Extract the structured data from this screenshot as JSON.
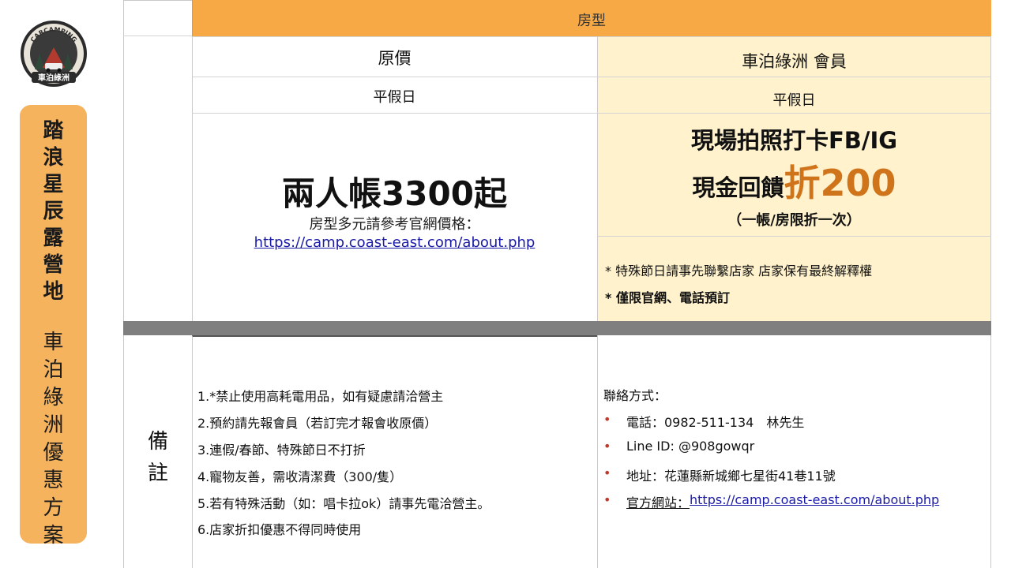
{
  "logo": {
    "ring_text": "CARCAMPING",
    "plate_text": "車泊綠洲"
  },
  "side_panel": {
    "title_chars": [
      "踏",
      "浪",
      "星",
      "辰",
      "露",
      "營",
      "地"
    ],
    "subtitle_chars": [
      "車",
      "泊",
      "綠",
      "洲",
      "優",
      "惠",
      "方",
      "案"
    ]
  },
  "table": {
    "header": "房型",
    "col_left_title": "原價",
    "col_right_title": "車泊綠洲 會員",
    "weekday_left": "平假日",
    "weekday_right": "平假日",
    "big_price": "兩人帳3300起",
    "price_note": "房型多元請參考官網價格：",
    "price_link": "https://camp.coast-east.com/about.php",
    "promo_line1": "現場拍照打卡FB/IG",
    "promo_line2_prefix": "現金回饋",
    "promo_highlight": "折200",
    "promo_limit": "（一帳/房限折一次）",
    "note_1": "* 特殊節日請事先聯繫店家 店家保有最終解釋權",
    "note_2": "* 僅限官網、電話預訂"
  },
  "remarks": {
    "label_chars": [
      "備",
      "註"
    ],
    "rules": [
      "1.*禁止使用高耗電用品，如有疑慮請洽營主",
      "2.預約請先報會員（若訂完才報會收原價）",
      "3.連假/春節、特殊節日不打折",
      "4.寵物友善，需收清潔費（300/隻）",
      "5.若有特殊活動（如：唱卡拉ok）請事先電洽營主。",
      "6.店家折扣優惠不得同時使用"
    ],
    "contact_title": "聯絡方式：",
    "bullet": "•",
    "contact_phone": "電話：0982-511-134　林先生",
    "contact_line": "Line ID: @908gowqr",
    "contact_address": "地址：花蓮縣新城鄉七星街41巷11號",
    "contact_site_label": "官方網站：",
    "contact_site_url": "https://camp.coast-east.com/about.php"
  },
  "colors": {
    "header_orange": "#f7a945",
    "side_pill_orange": "#f5b35d",
    "member_cream": "#fff2cc",
    "highlight_orange": "#d0741b",
    "divider_gray": "#7f7f7f",
    "bullet_red": "#c0392b"
  }
}
